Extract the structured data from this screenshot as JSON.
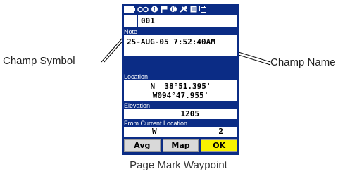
{
  "callouts": {
    "symbol": "Champ Symbol",
    "name": "Champ Name"
  },
  "caption": "Page Mark Waypoint",
  "waypoint": {
    "name": "001",
    "note_label": "Note",
    "note": "25-AUG-05 7:52:40AM",
    "location_label": "Location",
    "lat": "N  38°51.395'",
    "lon": "W094°47.955'",
    "elevation_label": "Elevation",
    "elevation": "1205",
    "from_label": "From Current Location",
    "from_direction": "W",
    "from_distance": "2"
  },
  "buttons": {
    "avg": "Avg",
    "map": "Map",
    "ok": "OK"
  },
  "status_icons": [
    "battery-icon",
    "signal-icon",
    "gps-icon",
    "flag-icon",
    "globe-icon",
    "satellite-icon",
    "page-icon",
    "menu-icon"
  ],
  "colors": {
    "screen_bg": "#0b2c85",
    "ok_button": "#f7f200"
  }
}
